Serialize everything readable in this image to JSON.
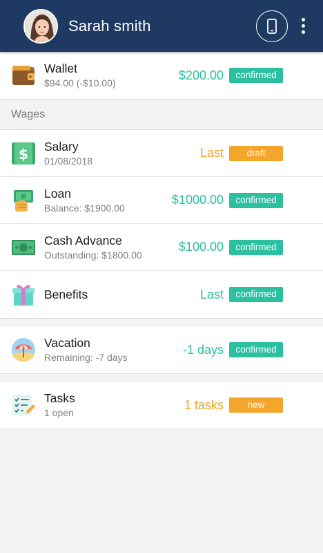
{
  "header": {
    "user_name": "Sarah smith",
    "background": "#1e3a63"
  },
  "wallet": {
    "title": "Wallet",
    "sub": "$94.00 (-$10.00)",
    "amount": "$200.00",
    "status": "confirmed"
  },
  "wages": {
    "section_label": "Wages",
    "items": [
      {
        "title": "Salary",
        "sub": "01/08/2018",
        "amount": "Last",
        "status": "draft"
      },
      {
        "title": "Loan",
        "sub": "Balance: $1900.00",
        "amount": "$1000.00",
        "status": "confirmed"
      },
      {
        "title": "Cash Advance",
        "sub": "Outstanding: $1800.00",
        "amount": "$100.00",
        "status": "confirmed"
      },
      {
        "title": "Benefits",
        "sub": "",
        "amount": "Last",
        "status": "confirmed"
      }
    ]
  },
  "vacation": {
    "title": "Vacation",
    "sub": "Remaining: -7 days",
    "amount": "-1 days",
    "status": "confirmed"
  },
  "tasks": {
    "title": "Tasks",
    "sub": "1 open",
    "amount": "1 tasks",
    "status": "new"
  },
  "colors": {
    "teal": "#2cbfa0",
    "orange": "#f4a62a"
  }
}
